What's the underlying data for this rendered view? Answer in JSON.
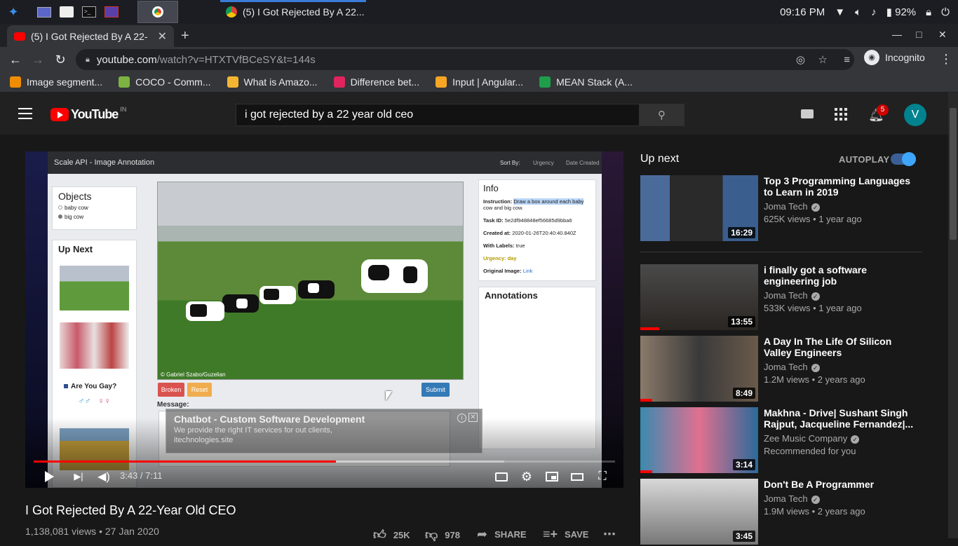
{
  "taskbar": {
    "window_title": "(5) I Got Rejected By A 22...",
    "time": "09:16 PM",
    "battery": "92%"
  },
  "browser": {
    "tab_title": "(5) I Got Rejected By A 22-",
    "url_host": "youtube.com",
    "url_path": "/watch?v=HTXTVfBCeSY&t=144s",
    "incognito_label": "Incognito",
    "bookmarks": [
      {
        "label": "Image segment...",
        "color": "#f08c00"
      },
      {
        "label": "COCO - Comm...",
        "color": "#7cb342"
      },
      {
        "label": "What is Amazo...",
        "color": "#f2b632"
      },
      {
        "label": "Difference bet...",
        "color": "#e0245e"
      },
      {
        "label": "Input | Angular...",
        "color": "#f6a623"
      },
      {
        "label": "MEAN Stack (A...",
        "color": "#1e9e4a"
      }
    ]
  },
  "youtube": {
    "logo_text": "YouTube",
    "region": "IN",
    "search_value": "i got rejected by a 22 year old ceo",
    "notifications": "5",
    "avatar_letter": "V"
  },
  "player": {
    "time": "3:43 / 7:11",
    "progress_played": 0.52,
    "progress_loaded": 0.81,
    "screen": {
      "app_title": "Scale API - Image Annotation",
      "sort_by": "Sort By:",
      "sort_urgency": "Urgency",
      "sort_date": "Date Created",
      "objects_title": "Objects",
      "objects": [
        "baby cow",
        "big cow"
      ],
      "upnext_title": "Up Next",
      "upnext_q": "Are You Gay?",
      "info_title": "Info",
      "instruction_label": "Instruction:",
      "instruction": "Draw a box around each baby",
      "instruction_2": "cow and big cow.",
      "task_id_label": "Task ID:",
      "task_id": "5e2df948848ef56685d9bba6",
      "created_label": "Created at:",
      "created": "2020-01-26T20:40:40.840Z",
      "labels_label": "With Labels:",
      "labels": "true",
      "urgency": "Urgency: day",
      "original_label": "Original Image:",
      "original_link": "Link",
      "annotations_title": "Annotations",
      "broken": "Broken",
      "reset": "Reset",
      "submit": "Submit",
      "message": "Message:",
      "credit": "© Gabriel Szabo/Guzelian"
    },
    "ad": {
      "title": "Chatbot - Custom Software Development",
      "line1": "We provide the right IT services for out clients,",
      "line2": "itechnologies.site"
    }
  },
  "video": {
    "title": "I Got Rejected By A 22-Year Old CEO",
    "meta": "1,138,081 views • 27 Jan 2020",
    "likes": "25K",
    "dislikes": "978",
    "share": "SHARE",
    "save": "SAVE"
  },
  "upnext": {
    "label": "Up next",
    "autoplay": "AUTOPLAY",
    "items": [
      {
        "title": "Top 3 Programming Languages to Learn in 2019",
        "channel": "Joma Tech",
        "meta": "625K views • 1 year ago",
        "duration": "16:29",
        "watched": 0
      },
      {
        "title": "i finally got a software engineering job",
        "channel": "Joma Tech",
        "meta": "533K views • 1 year ago",
        "duration": "13:55",
        "watched": 0.16
      },
      {
        "title": "A Day In The Life Of Silicon Valley Engineers",
        "channel": "Joma Tech",
        "meta": "1.2M views • 2 years ago",
        "duration": "8:49",
        "watched": 0.1
      },
      {
        "title": "Makhna - Drive| Sushant Singh Rajput, Jacqueline Fernandez|...",
        "channel": "Zee Music Company",
        "meta": "Recommended for you",
        "duration": "3:14",
        "watched": 0.1
      },
      {
        "title": "Don't Be A Programmer",
        "channel": "Joma Tech",
        "meta": "1.9M views • 2 years ago",
        "duration": "3:45",
        "watched": 0
      }
    ]
  }
}
